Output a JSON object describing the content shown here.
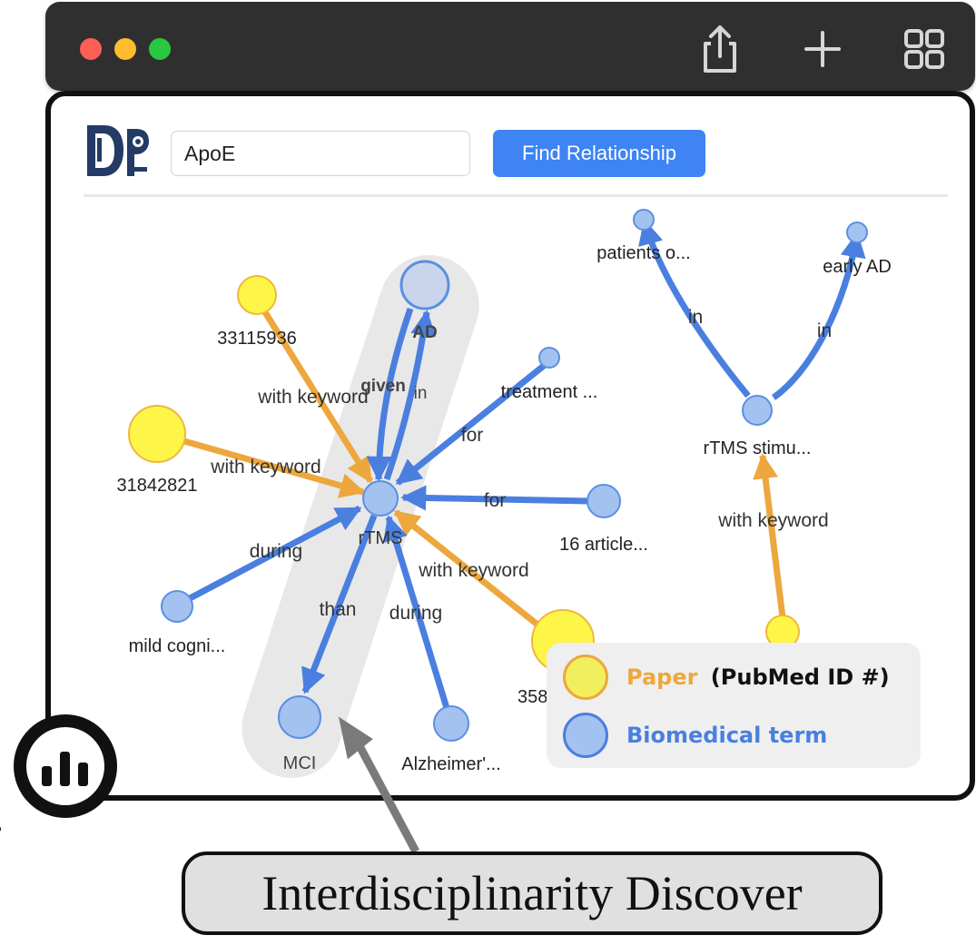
{
  "search": {
    "value": "ApoE"
  },
  "toolbar": {
    "find_label": "Find Relationship"
  },
  "legend": {
    "paper_label": "Paper",
    "paper_suffix": "(PubMed ID #)",
    "term_label": "Biomedical term"
  },
  "caption": "Interdisciplinarity Discover",
  "colors": {
    "paper_fill": "#fdf547",
    "paper_stroke": "#f0b63e",
    "term_fill": "#a4c2ef",
    "term_stroke": "#5b8fe4",
    "edge_paper": "#eda73d",
    "edge_term": "#4a7fe0",
    "accent_button": "#3e84f3"
  },
  "graph": {
    "nodes": {
      "rtms": "rTMS",
      "ad": "AD",
      "mci": "MCI",
      "alz": "Alzheimer'...",
      "mild": "mild cogni...",
      "articles16": "16 article...",
      "treatment": "treatment ...",
      "p33115936": "33115936",
      "p31842821": "31842821",
      "p358": "358",
      "patients": "patients o...",
      "earlyad": "early AD",
      "rtmsstim": "rTMS stimu..."
    },
    "edges": {
      "kw1": "with keyword",
      "kw2": "with keyword",
      "kw3": "with keyword",
      "kw4": "with keyword",
      "given": "given",
      "in1": "in",
      "for1": "for",
      "for2": "for",
      "during1": "during",
      "during2": "during",
      "than": "than",
      "in2": "in",
      "in3": "in"
    }
  }
}
